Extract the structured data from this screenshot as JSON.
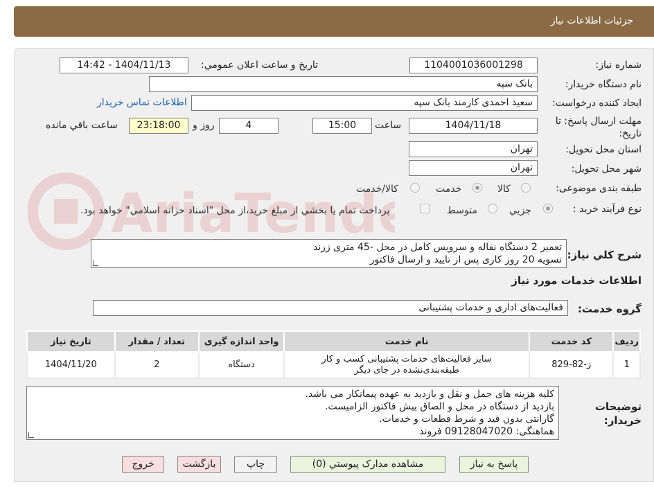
{
  "header": {
    "title": "جزئیات اطلاعات نیاز"
  },
  "form": {
    "need_number_label": "شماره نیاز:",
    "need_number": "1104001036001298",
    "announce_label": "تاریخ و ساعت اعلان عمومي:",
    "announce_value": "1404/11/13 - 14:42",
    "buyer_org_label": "نام دستگاه خريدار:",
    "buyer_org": "بانک سپه",
    "requester_label": "ايجاد كننده درخواست:",
    "requester": "سعید احمدی کارمند بانک سپه",
    "contact_link": "اطلاعات تماس خريدار",
    "deadline_label": "مهلت ارسال پاسخ: تا تاریخ:",
    "deadline_date": "1404/11/18",
    "time_label": "ساعت",
    "deadline_time": "15:00",
    "days_value": "4",
    "days_label": "روز و",
    "remaining_time": "23:18:00",
    "remaining_label": "ساعت باقي مانده",
    "province_label": "استان محل تحويل:",
    "province": "تهران",
    "city_label": "شهر محل تحويل:",
    "city": "تهران",
    "category_label": "طبقه بندی موضوعی:",
    "category_options": [
      "كالا",
      "خدمت",
      "كالا/خدمت"
    ],
    "category_selected": "خدمت",
    "process_label": "نوع فرآیند خرید :",
    "process_options": [
      "جزيي",
      "متوسط"
    ],
    "process_selected": "جزيي",
    "payment_note": "پرداخت تمام يا بخشي از مبلغ خريد،از محل \"اسناد خزانه اسلامي\" خواهد بود."
  },
  "description": {
    "label": "شرح كلي نياز:",
    "lines": [
      "تعمیر 2 دستگاه نقاله و سرویس کامل در محل -45 متری زرند",
      "تسویه 20 روز کاری پس از تایید و ارسال فاکتور"
    ]
  },
  "services": {
    "title": "اطلاعات خدمات مورد نياز",
    "group_label": "گروه خدمت:",
    "group_value": "فعالیت‌های اداری و خدمات پشتیبانی",
    "table": {
      "headers": [
        "رديف",
        "كد خدمت",
        "نام خدمت",
        "واحد اندازه گيری",
        "تعداد / مقدار",
        "تاريخ نياز"
      ],
      "rows": [
        {
          "index": "1",
          "code": "ز-82-829",
          "name_line1": "سایر فعالیت‌های خدمات پشتیبانی کسب و کار",
          "name_line2": "طبقه‌بندی‌نشده در جای دیگر",
          "unit": "دستگاه",
          "quantity": "2",
          "date": "1404/11/20"
        }
      ]
    }
  },
  "buyer_notes": {
    "label": "توضيحات خريدار:",
    "lines": [
      "کلیه هزینه های حمل و نقل و بازدید به عهده پیمانکار می باشد.",
      "بازدید از دستگاه در محل و الصاق پیش فاکتور الزامیست.",
      "گارانتی بدون قید و شرط قطعات و خدمات.",
      "هماهنگی: 09128047020 فروند"
    ]
  },
  "buttons": {
    "reply": "پاسخ به نياز",
    "attachments": "مشاهده مدارک پيوستي (0)",
    "print": "چاپ",
    "back": "بازگشت",
    "exit": "خروج"
  },
  "watermark": {
    "text": "AriaTender.neT"
  }
}
